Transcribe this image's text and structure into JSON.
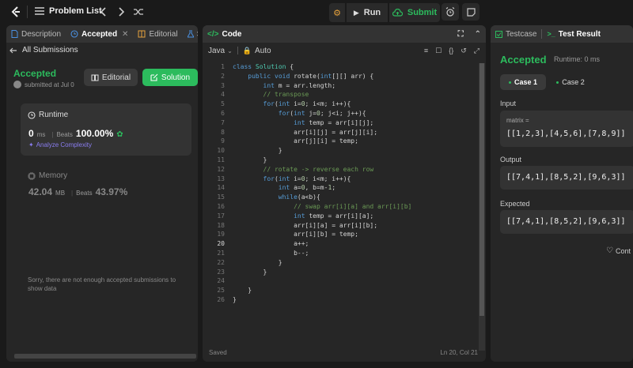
{
  "topbar": {
    "title": "Problem List",
    "run_label": "Run",
    "submit_label": "Submit"
  },
  "left": {
    "tabs": [
      "Description",
      "Accepted",
      "Editorial",
      "S"
    ],
    "all_submissions": "All Submissions",
    "status": "Accepted",
    "submitted_at": "submitted at Jul 0",
    "editorial_btn": "Editorial",
    "solution_btn": "Solution",
    "runtime": {
      "label": "Runtime",
      "value": "0",
      "unit": "ms",
      "beats_label": "Beats",
      "beats": "100.00%",
      "analyze": "Analyze Complexity"
    },
    "memory": {
      "label": "Memory",
      "value": "42.04",
      "unit": "MB",
      "beats_label": "Beats",
      "beats": "43.97%"
    },
    "sorry": "Sorry, there are not enough accepted submissions to show data"
  },
  "editor": {
    "title": "Code",
    "language": "Java",
    "auto": "Auto",
    "status_left": "Saved",
    "status_right": "Ln 20, Col 21",
    "current_line": 20,
    "lines": [
      "class Solution {",
      "    public void rotate(int[][] arr) {",
      "        int m = arr.length;",
      "        // transpose",
      "        for(int i=0; i<m; i++){",
      "            for(int j=0; j<i; j++){",
      "                int temp = arr[i][j];",
      "                arr[i][j] = arr[j][i];",
      "                arr[j][i] = temp;",
      "            }",
      "        }",
      "        // rotate -> reverse each row",
      "        for(int i=0; i<m; i++){",
      "            int a=0, b=m-1;",
      "            while(a<b){",
      "                // swap arr[i][a] and arr[i][b]",
      "                int temp = arr[i][a];",
      "                arr[i][a] = arr[i][b];",
      "                arr[i][b] = temp;",
      "                a++;",
      "                b--;",
      "            }",
      "        }",
      "",
      "    }",
      "}"
    ]
  },
  "right": {
    "tab_testcase": "Testcase",
    "tab_result": "Test Result",
    "status": "Accepted",
    "runtime": "Runtime: 0 ms",
    "cases": [
      "Case 1",
      "Case 2"
    ],
    "input_label": "Input",
    "param_name": "matrix =",
    "input_value": "[[1,2,3],[4,5,6],[7,8,9]]",
    "output_label": "Output",
    "output_value": "[[7,4,1],[8,5,2],[9,6,3]]",
    "expected_label": "Expected",
    "expected_value": "[[7,4,1],[8,5,2],[9,6,3]]",
    "contribute": "Cont"
  },
  "colors": {
    "accent_green": "#2cbb5d",
    "bg": "#1a1a1a",
    "panel": "#262626"
  }
}
